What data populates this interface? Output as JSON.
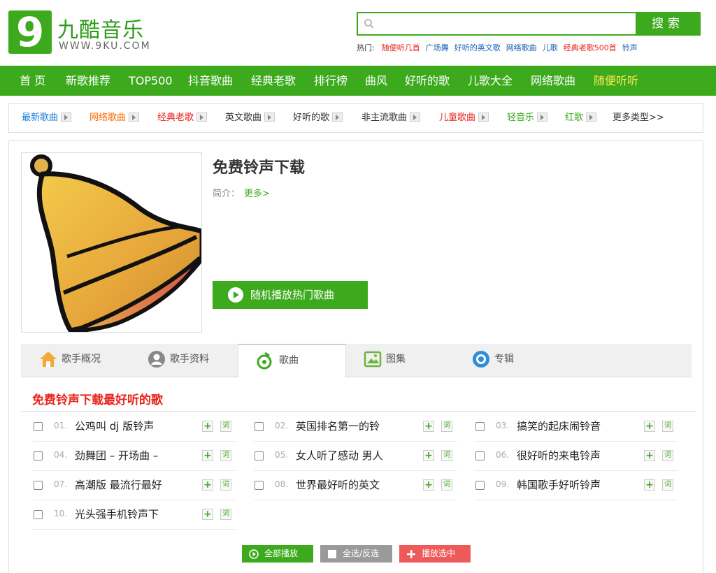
{
  "header": {
    "logo_num": "9",
    "logo_cn": "九酷音乐",
    "logo_url": "WWW.9KU.COM",
    "search": {
      "placeholder": "",
      "button": "搜索"
    },
    "hot": {
      "label": "热门:",
      "items": [
        {
          "text": "随便听几首",
          "color": "#e8241c"
        },
        {
          "text": "广场舞",
          "color": "#1a5fb4"
        },
        {
          "text": "好听的英文歌",
          "color": "#1a5fb4"
        },
        {
          "text": "网络歌曲",
          "color": "#1a5fb4"
        },
        {
          "text": "儿歌",
          "color": "#1a5fb4"
        },
        {
          "text": "经典老歌500首",
          "color": "#e8241c"
        },
        {
          "text": "铃声",
          "color": "#1a5fb4"
        }
      ]
    }
  },
  "nav": {
    "items": [
      "首 页",
      "新歌推荐",
      "TOP500",
      "抖音歌曲",
      "经典老歌",
      "排行榜",
      "曲风",
      "好听的歌",
      "儿歌大全",
      "网络歌曲",
      "随便听听"
    ]
  },
  "subnav": {
    "items": [
      {
        "text": "最新歌曲",
        "color": "#1a7fd4"
      },
      {
        "text": "网络歌曲",
        "color": "#ff6a00"
      },
      {
        "text": "经典老歌",
        "color": "#e8241c"
      },
      {
        "text": "英文歌曲",
        "color": "#333333"
      },
      {
        "text": "好听的歌",
        "color": "#333333"
      },
      {
        "text": "非主流歌曲",
        "color": "#333333"
      },
      {
        "text": "儿童歌曲",
        "color": "#e8241c"
      },
      {
        "text": "轻音乐",
        "color": "#3daa1e"
      },
      {
        "text": "红歌",
        "color": "#3daa1e"
      }
    ],
    "more": "更多类型>>"
  },
  "artist": {
    "title": "免费铃声下载",
    "intro_label": "简介：",
    "intro_more": "更多>",
    "play_hot": "随机播放热门歌曲"
  },
  "tabs": [
    "歌手概况",
    "歌手资料",
    "歌曲",
    "图集",
    "专辑"
  ],
  "songs_title": "免费铃声下载最好听的歌",
  "songs": [
    {
      "num": "01.",
      "name": "公鸡叫 dj 版铃声"
    },
    {
      "num": "02.",
      "name": "英国排名第一的铃"
    },
    {
      "num": "03.",
      "name": "搞笑的起床闹铃音"
    },
    {
      "num": "04.",
      "name": "劲舞团 – 开场曲 –"
    },
    {
      "num": "05.",
      "name": "女人听了感动 男人"
    },
    {
      "num": "06.",
      "name": "很好听的来电铃声"
    },
    {
      "num": "07.",
      "name": "高潮版 最流行最好"
    },
    {
      "num": "08.",
      "name": "世界最好听的英文"
    },
    {
      "num": "09.",
      "name": "韩国歌手好听铃声"
    },
    {
      "num": "10.",
      "name": "光头强手机铃声下"
    }
  ],
  "song_actions": {
    "add": "+",
    "lyric": "词"
  },
  "buttons": {
    "play_all": "全部播放",
    "select": "全选/反选",
    "play_selected": "播放选中"
  },
  "colors": {
    "brand": "#3daa1e",
    "red": "#e8241c",
    "gray_btn": "#9a9a9a",
    "pink_btn": "#ee5a5a"
  }
}
